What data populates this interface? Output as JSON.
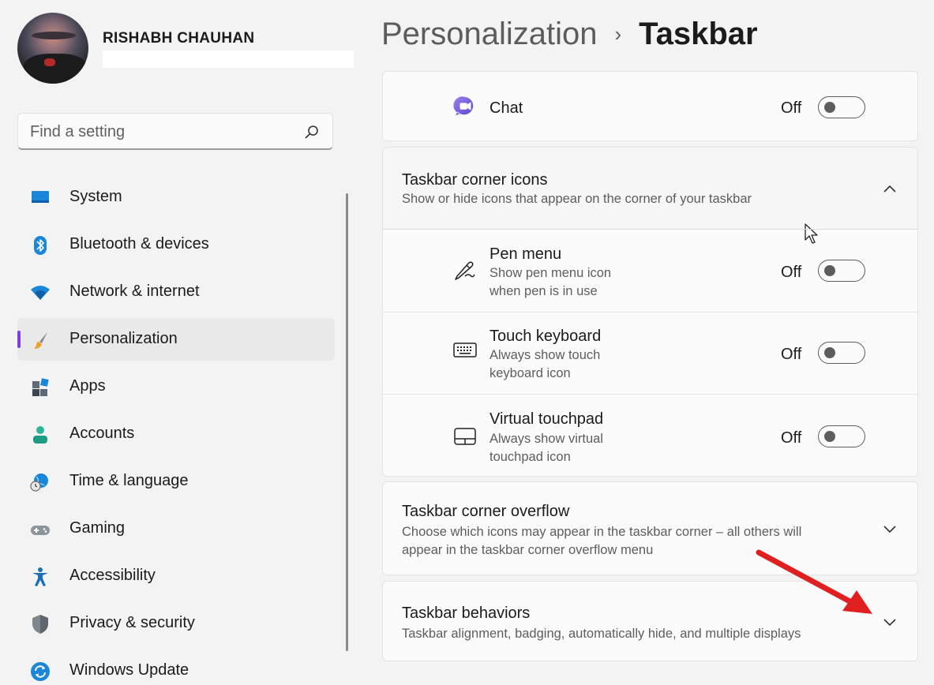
{
  "profile": {
    "name": "RISHABH CHAUHAN"
  },
  "search": {
    "placeholder": "Find a setting"
  },
  "nav": {
    "items": [
      {
        "label": "System"
      },
      {
        "label": "Bluetooth & devices"
      },
      {
        "label": "Network & internet"
      },
      {
        "label": "Personalization"
      },
      {
        "label": "Apps"
      },
      {
        "label": "Accounts"
      },
      {
        "label": "Time & language"
      },
      {
        "label": "Gaming"
      },
      {
        "label": "Accessibility"
      },
      {
        "label": "Privacy & security"
      },
      {
        "label": "Windows Update"
      }
    ],
    "active_index": 3,
    "accent_color": "#7b3fe4"
  },
  "breadcrumb": {
    "parent": "Personalization",
    "separator": "›",
    "current": "Taskbar"
  },
  "chat": {
    "label": "Chat",
    "status": "Off",
    "icon": "chat-icon"
  },
  "corner_icons": {
    "title": "Taskbar corner icons",
    "description": "Show or hide icons that appear on the corner of your taskbar",
    "expanded": true,
    "items": [
      {
        "title": "Pen menu",
        "desc_line1": "Show pen menu icon",
        "desc_line2": "when pen is in use",
        "status": "Off",
        "icon": "pen-icon"
      },
      {
        "title": "Touch keyboard",
        "desc_line1": "Always show touch",
        "desc_line2": "keyboard icon",
        "status": "Off",
        "icon": "keyboard-icon"
      },
      {
        "title": "Virtual touchpad",
        "desc_line1": "Always show virtual",
        "desc_line2": "touchpad icon",
        "status": "Off",
        "icon": "touchpad-icon"
      }
    ]
  },
  "corner_overflow": {
    "title": "Taskbar corner overflow",
    "desc_line1": "Choose which icons may appear in the taskbar corner – all others will",
    "desc_line2": "appear in the taskbar corner overflow menu"
  },
  "behaviors": {
    "title": "Taskbar behaviors",
    "description": "Taskbar alignment, badging, automatically hide, and multiple displays"
  },
  "annotation": {
    "arrow_color": "#e02020"
  }
}
